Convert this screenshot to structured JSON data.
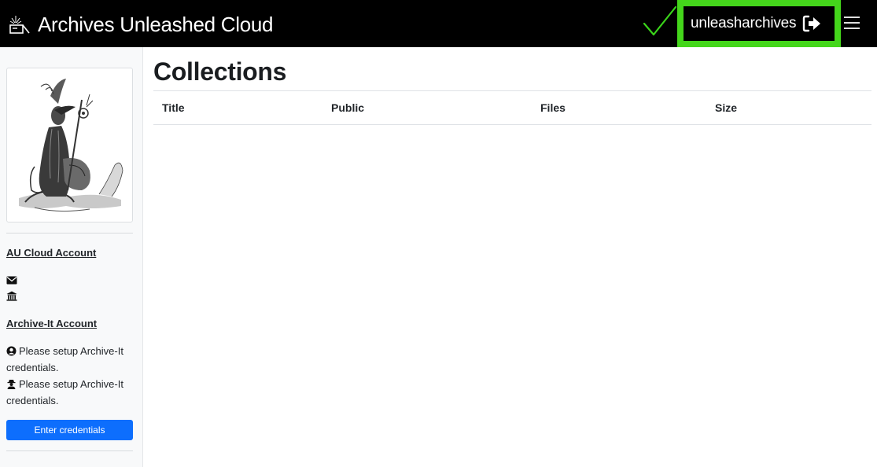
{
  "navbar": {
    "brand_title": "Archives Unleashed Cloud",
    "username": "unleasharchives",
    "highlight_color": "#44d61b",
    "check_color": "#3ad41a",
    "icons": [
      "brand-logo-icon",
      "checkmark-icon",
      "logout-icon",
      "hamburger-menu-icon"
    ]
  },
  "sidebar": {
    "au_account_heading": "AU Cloud Account",
    "archive_it_heading": "Archive-It Account",
    "credential_lines": [
      "Please setup Archive-It credentials.",
      "Please setup Archive-It credentials."
    ],
    "enter_credentials_label": "Enter credentials",
    "icons": [
      "envelope-icon",
      "institution-icon",
      "user-circle-icon",
      "user-secret-icon"
    ],
    "button_color": "#0d6efd"
  },
  "main": {
    "title": "Collections",
    "table_headers": [
      "Title",
      "Public",
      "Files",
      "Size"
    ],
    "rows": []
  }
}
